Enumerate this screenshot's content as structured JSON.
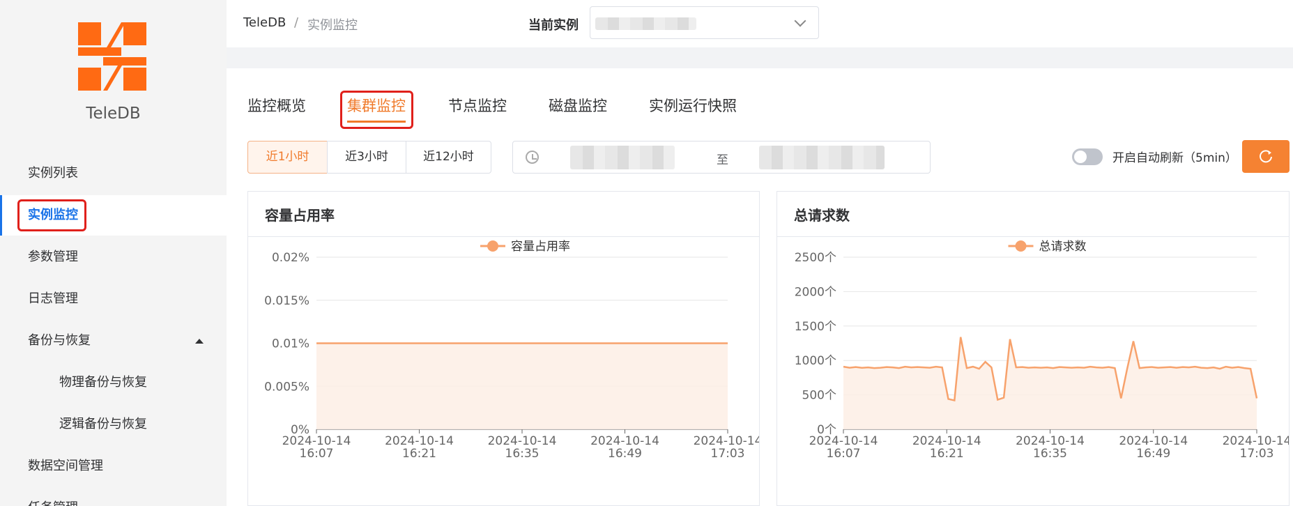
{
  "sidebar": {
    "brand": "TeleDB",
    "items": [
      {
        "label": "实例列表"
      },
      {
        "label": "实例监控"
      },
      {
        "label": "参数管理"
      },
      {
        "label": "日志管理"
      },
      {
        "label": "备份与恢复"
      },
      {
        "label": "物理备份与恢复"
      },
      {
        "label": "逻辑备份与恢复"
      },
      {
        "label": "数据空间管理"
      },
      {
        "label": "任务管理"
      }
    ]
  },
  "breadcrumb": {
    "root": "TeleDB",
    "separator": "/",
    "current": "实例监控"
  },
  "instance": {
    "label": "当前实例"
  },
  "tabs": [
    "监控概览",
    "集群监控",
    "节点监控",
    "磁盘监控",
    "实例运行快照"
  ],
  "time_ranges": [
    "近1小时",
    "近3小时",
    "近12小时"
  ],
  "date_range": {
    "separator": "至"
  },
  "auto_refresh": {
    "label": "开启自动刷新（5min）"
  },
  "colors": {
    "accent": "#f07a2b",
    "highlight": "#e0201b",
    "active_menu": "#1a73e8"
  },
  "charts": {
    "capacity": {
      "title": "容量占用率"
    },
    "requests": {
      "title": "总请求数"
    }
  },
  "chart_data": [
    {
      "type": "area",
      "title": "容量占用率",
      "legend": [
        "容量占用率"
      ],
      "legend_position": "top-center",
      "grid": true,
      "y_ticks": [
        "0%",
        "0.005%",
        "0.01%",
        "0.015%",
        "0.02%"
      ],
      "ylim": [
        0,
        0.02
      ],
      "x_ticks": [
        "2024-10-14 16:07",
        "2024-10-14 16:21",
        "2024-10-14 16:35",
        "2024-10-14 16:49",
        "2024-10-14 17:03"
      ],
      "series": [
        {
          "name": "容量占用率",
          "values": [
            0.01,
            0.01,
            0.01,
            0.01,
            0.01,
            0.01,
            0.01,
            0.01,
            0.01,
            0.01,
            0.01,
            0.01,
            0.01,
            0.01,
            0.01,
            0.01,
            0.01,
            0.01,
            0.01,
            0.01,
            0.01,
            0.01,
            0.01,
            0.01,
            0.01,
            0.01,
            0.01,
            0.01,
            0.01,
            0.01,
            0.01,
            0.01,
            0.01,
            0.01,
            0.01,
            0.01,
            0.01,
            0.01,
            0.01,
            0.01,
            0.01,
            0.01,
            0.01,
            0.01,
            0.01,
            0.01,
            0.01,
            0.01,
            0.01,
            0.01,
            0.01,
            0.01,
            0.01,
            0.01,
            0.01,
            0.01,
            0.01,
            0.01,
            0.01,
            0.01,
            0.01
          ]
        }
      ]
    },
    {
      "type": "area",
      "title": "总请求数",
      "legend": [
        "总请求数"
      ],
      "legend_position": "top-center",
      "grid": true,
      "y_ticks": [
        "0个",
        "500个",
        "1000个",
        "1500个",
        "2000个",
        "2500个"
      ],
      "ylim": [
        0,
        2500
      ],
      "x_ticks": [
        "2024-10-14 16:07",
        "2024-10-14 16:21",
        "2024-10-14 16:35",
        "2024-10-14 16:49",
        "2024-10-14 17:03"
      ],
      "series": [
        {
          "name": "总请求数",
          "values": [
            910,
            895,
            905,
            893,
            900,
            890,
            895,
            905,
            900,
            890,
            910,
            900,
            905,
            900,
            895,
            910,
            900,
            440,
            420,
            1340,
            890,
            910,
            880,
            980,
            900,
            430,
            460,
            1310,
            900,
            905,
            895,
            900,
            895,
            900,
            890,
            905,
            900,
            895,
            900,
            895,
            910,
            900,
            895,
            905,
            890,
            450,
            880,
            1280,
            890,
            900,
            905,
            895,
            900,
            905,
            895,
            905,
            900,
            910,
            895,
            890,
            900,
            880,
            910,
            895,
            905,
            890,
            880,
            450
          ]
        }
      ]
    }
  ]
}
